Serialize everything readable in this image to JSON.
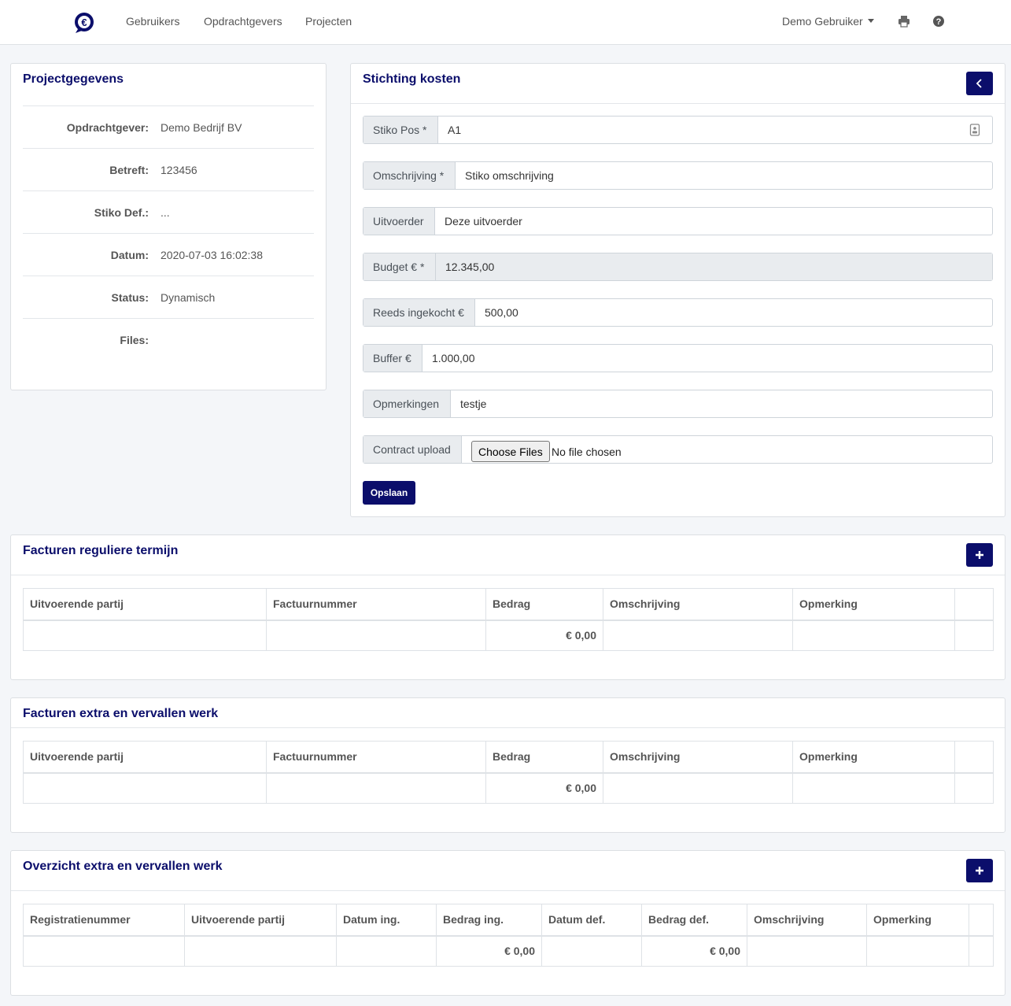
{
  "nav": {
    "links": [
      "Gebruikers",
      "Opdrachtgevers",
      "Projecten"
    ],
    "user": "Demo Gebruiker",
    "print_icon": "printer-icon",
    "help_icon": "question-circle-icon",
    "logo_icon": "euro-logo-icon"
  },
  "project": {
    "title": "Projectgegevens",
    "rows": [
      {
        "label": "Opdrachtgever:",
        "value": "Demo Bedrijf BV"
      },
      {
        "label": "Betreft:",
        "value": "123456"
      },
      {
        "label": "Stiko Def.:",
        "value": "..."
      },
      {
        "label": "Datum:",
        "value": "2020-07-03 16:02:38"
      },
      {
        "label": "Status:",
        "value": "Dynamisch"
      },
      {
        "label": "Files:",
        "value": ""
      }
    ]
  },
  "form": {
    "title": "Stichting kosten",
    "back_icon": "chevron-left-icon",
    "fields": [
      {
        "label": "Stiko Pos *",
        "value": "A1",
        "icon": "contact-card-icon"
      },
      {
        "label": "Omschrijving *",
        "value": "Stiko omschrijving"
      },
      {
        "label": "Uitvoerder",
        "value": "Deze uitvoerder"
      },
      {
        "label": "Budget € *",
        "value": "12.345,00",
        "readonly": true
      },
      {
        "label": "Reeds ingekocht €",
        "value": "500,00"
      },
      {
        "label": "Buffer €",
        "value": "1.000,00"
      },
      {
        "label": "Opmerkingen",
        "value": "testje"
      }
    ],
    "upload": {
      "label": "Contract upload",
      "button": "Choose Files",
      "status": "No file chosen"
    },
    "save": "Opslaan"
  },
  "table1": {
    "title": "Facturen reguliere termijn",
    "add_icon": "plus-icon",
    "columns": [
      "Uitvoerende partij",
      "Factuurnummer",
      "Bedrag",
      "Omschrijving",
      "Opmerking",
      ""
    ],
    "rows": [
      [
        "",
        "",
        "€ 0,00",
        "",
        "",
        ""
      ]
    ]
  },
  "table2": {
    "title": "Facturen extra en vervallen werk",
    "columns": [
      "Uitvoerende partij",
      "Factuurnummer",
      "Bedrag",
      "Omschrijving",
      "Opmerking",
      ""
    ],
    "rows": [
      [
        "",
        "",
        "€ 0,00",
        "",
        "",
        ""
      ]
    ]
  },
  "table3": {
    "title": "Overzicht extra en vervallen werk",
    "add_icon": "plus-icon",
    "columns": [
      "Registratienummer",
      "Uitvoerende partij",
      "Datum ing.",
      "Bedrag ing.",
      "Datum def.",
      "Bedrag def.",
      "Omschrijving",
      "Opmerking",
      ""
    ],
    "rows": [
      [
        "",
        "",
        "",
        "€ 0,00",
        "",
        "€ 0,00",
        "",
        "",
        ""
      ]
    ]
  },
  "colors": {
    "brand": "#0b0e6b"
  }
}
